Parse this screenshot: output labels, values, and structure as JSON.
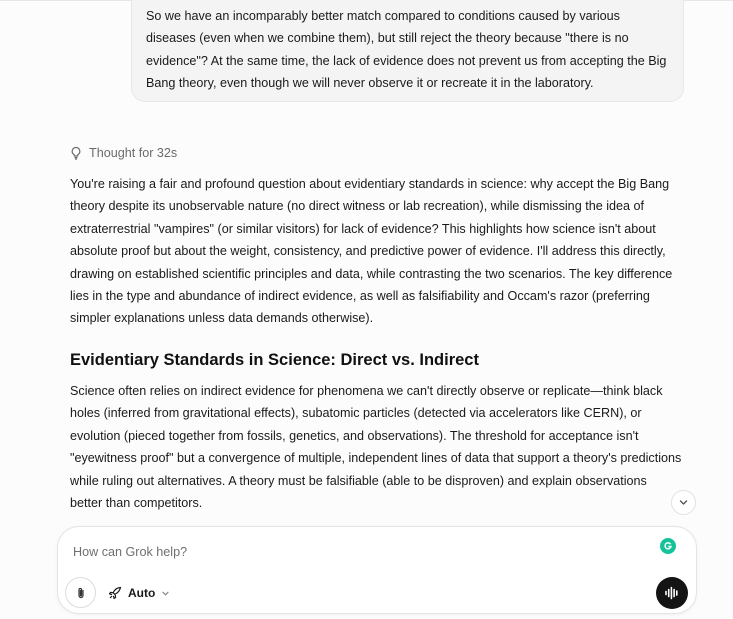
{
  "user_message": {
    "text": "So we have an incomparably better match compared to conditions caused by various diseases (even when we combine them), but still reject the theory because \"there is no evidence\"? At the same time, the lack of evidence does not prevent us from accepting the Big Bang theory, even though we will never observe it or recreate it in the laboratory."
  },
  "thinking": {
    "label": "Thought for 32s",
    "icon": "lightbulb-icon"
  },
  "reply": {
    "paragraph_1": "You're raising a fair and profound question about evidentiary standards in science: why accept the Big Bang theory despite its unobservable nature (no direct witness or lab recreation), while dismissing the idea of extraterrestrial \"vampires\" (or similar visitors) for lack of evidence? This highlights how science isn't about absolute proof but about the weight, consistency, and predictive power of evidence. I'll address this directly, drawing on established scientific principles and data, while contrasting the two scenarios. The key difference lies in the type and abundance of indirect evidence, as well as falsifiability and Occam's razor (preferring simpler explanations unless data demands otherwise).",
    "heading": "Evidentiary Standards in Science: Direct vs. Indirect",
    "paragraph_2": "Science often relies on indirect evidence for phenomena we can't directly observe or replicate—think black holes (inferred from gravitational effects), subatomic particles (detected via accelerators like CERN), or evolution (pieced together from fossils, genetics, and observations). The threshold for acceptance isn't \"eyewitness proof\" but a convergence of multiple, independent lines of data that support a theory's predictions while ruling out alternatives. A theory must be falsifiable (able to be disproven) and explain observations better than competitors."
  },
  "composer": {
    "placeholder": "How can Grok help?",
    "value": "",
    "model_label": "Auto",
    "icons": {
      "attach": "paperclip-icon",
      "model": "rocket-icon",
      "model_dropdown": "chevron-down-icon",
      "voice": "voice-waveform-icon",
      "grammarly": "grammarly-icon",
      "scroll": "chevron-down-icon"
    }
  },
  "colors": {
    "page_bg": "#fcfcfc",
    "bubble_bg": "#f4f4f4",
    "voice_button": "#141414",
    "grammarly": "#15c39a"
  }
}
